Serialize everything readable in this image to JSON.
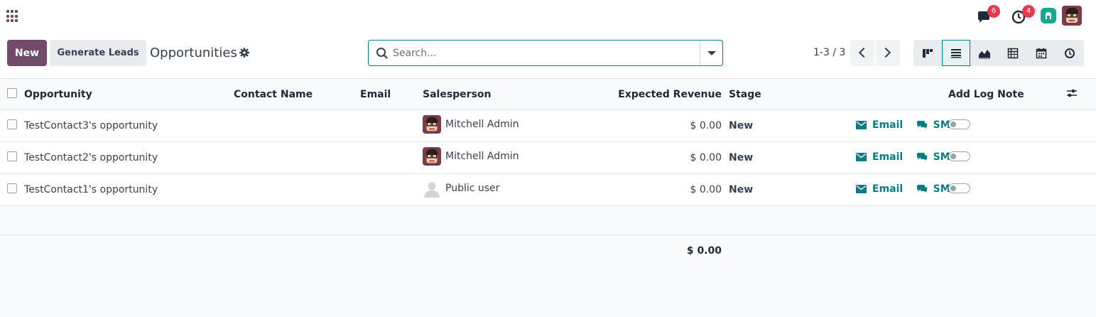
{
  "navbar": {
    "messages_badge": "6",
    "activities_badge": "4"
  },
  "control_panel": {
    "new_label": "New",
    "generate_leads_label": "Generate Leads",
    "title": "Opportunities",
    "search_placeholder": "Search...",
    "pager": "1-3 / 3"
  },
  "view_switcher": [
    "kanban-view-icon",
    "list-view-icon",
    "graph-view-icon",
    "pivot-view-icon",
    "calendar-view-icon",
    "activity-view-icon"
  ],
  "table": {
    "headers": {
      "opportunity": "Opportunity",
      "contact_name": "Contact Name",
      "email": "Email",
      "salesperson": "Salesperson",
      "expected_revenue": "Expected Revenue",
      "stage": "Stage",
      "add_log_note": "Add Log Note"
    },
    "rows": [
      {
        "opportunity": "TestContact3's opportunity",
        "contact_name": "",
        "email": "",
        "salesperson": "Mitchell Admin",
        "avatar": "admin",
        "revenue": "$ 0.00",
        "stage": "New",
        "email_action": "Email",
        "sms_action": "SMS"
      },
      {
        "opportunity": "TestContact2's opportunity",
        "contact_name": "",
        "email": "",
        "salesperson": "Mitchell Admin",
        "avatar": "admin",
        "revenue": "$ 0.00",
        "stage": "New",
        "email_action": "Email",
        "sms_action": "SMS"
      },
      {
        "opportunity": "TestContact1's opportunity",
        "contact_name": "",
        "email": "",
        "salesperson": "Public user",
        "avatar": "public",
        "revenue": "$ 0.00",
        "stage": "New",
        "email_action": "Email",
        "sms_action": "SMS"
      }
    ],
    "total_revenue": "$ 0.00"
  },
  "colors": {
    "brand": "#714B67",
    "accent": "#017e84",
    "badge": "#e63b4d"
  }
}
